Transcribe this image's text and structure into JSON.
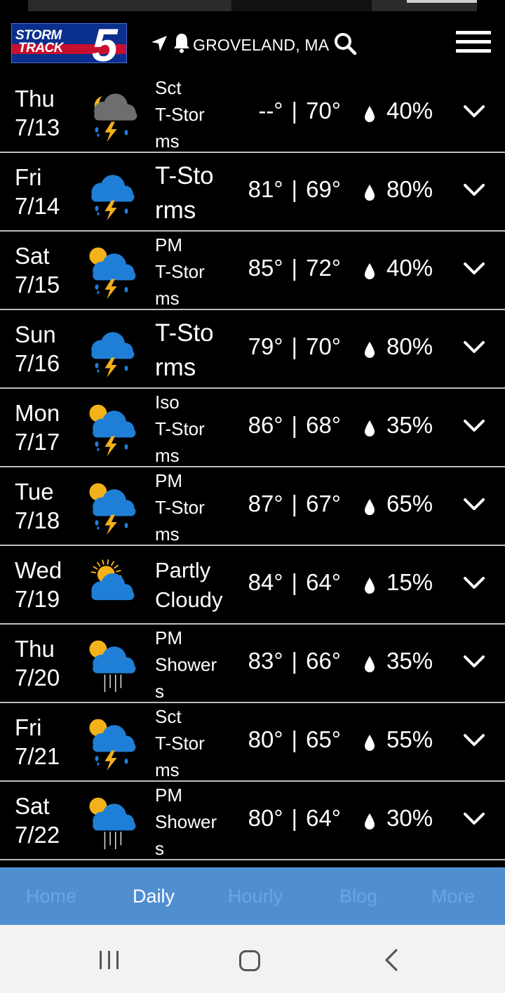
{
  "header": {
    "logo": {
      "word1": "STORM",
      "word2": "TRACK",
      "number": "5"
    },
    "location": "GROVELAND, MA",
    "icons": [
      "location-arrow-icon",
      "bell-icon",
      "search-icon",
      "hamburger-menu-icon"
    ]
  },
  "forecast": [
    {
      "dow": "Thu",
      "date": "7/13",
      "icon": "night-tstorm-icon",
      "cond": [
        "Sct",
        "T-Stor",
        "ms"
      ],
      "high": "--°",
      "low": "70°",
      "precip": "40%"
    },
    {
      "dow": "Fri",
      "date": "7/14",
      "icon": "tstorm-icon",
      "cond": [
        "T-Sto",
        "rms"
      ],
      "high": "81°",
      "low": "69°",
      "precip": "80%"
    },
    {
      "dow": "Sat",
      "date": "7/15",
      "icon": "sun-tstorm-icon",
      "cond": [
        "PM",
        "T-Stor",
        "ms"
      ],
      "high": "85°",
      "low": "72°",
      "precip": "40%"
    },
    {
      "dow": "Sun",
      "date": "7/16",
      "icon": "tstorm-icon",
      "cond": [
        "T-Sto",
        "rms"
      ],
      "high": "79°",
      "low": "70°",
      "precip": "80%"
    },
    {
      "dow": "Mon",
      "date": "7/17",
      "icon": "sun-tstorm-icon",
      "cond": [
        "Iso",
        "T-Stor",
        "ms"
      ],
      "high": "86°",
      "low": "68°",
      "precip": "35%"
    },
    {
      "dow": "Tue",
      "date": "7/18",
      "icon": "sun-tstorm-icon",
      "cond": [
        "PM",
        "T-Stor",
        "ms"
      ],
      "high": "87°",
      "low": "67°",
      "precip": "65%"
    },
    {
      "dow": "Wed",
      "date": "7/19",
      "icon": "partly-cloudy-icon",
      "cond": [
        "Partly",
        "Cloudy"
      ],
      "high": "84°",
      "low": "64°",
      "precip": "15%"
    },
    {
      "dow": "Thu",
      "date": "7/20",
      "icon": "sun-showers-icon",
      "cond": [
        "PM",
        "Shower",
        "s"
      ],
      "high": "83°",
      "low": "66°",
      "precip": "35%"
    },
    {
      "dow": "Fri",
      "date": "7/21",
      "icon": "sun-tstorm-icon",
      "cond": [
        "Sct",
        "T-Stor",
        "ms"
      ],
      "high": "80°",
      "low": "65°",
      "precip": "55%"
    },
    {
      "dow": "Sat",
      "date": "7/22",
      "icon": "sun-showers-icon",
      "cond": [
        "PM",
        "Shower",
        "s"
      ],
      "high": "80°",
      "low": "64°",
      "precip": "30%"
    }
  ],
  "tabs": [
    {
      "label": "Home",
      "active": false
    },
    {
      "label": "Daily",
      "active": true
    },
    {
      "label": "Hourly",
      "active": false
    },
    {
      "label": "Blog",
      "active": false
    },
    {
      "label": "More",
      "active": false
    }
  ],
  "system_nav": {
    "icons": [
      "recent-apps-icon",
      "home-icon",
      "back-icon"
    ]
  },
  "colors": {
    "background": "#000000",
    "tabbar": "#4f8fd0",
    "tab_inactive": "#6aa6e1",
    "cloud_blue": "#1f7fd6",
    "cloud_grey": "#6d6e70",
    "sun": "#f4b21a",
    "bolt": "#f2b01e"
  }
}
